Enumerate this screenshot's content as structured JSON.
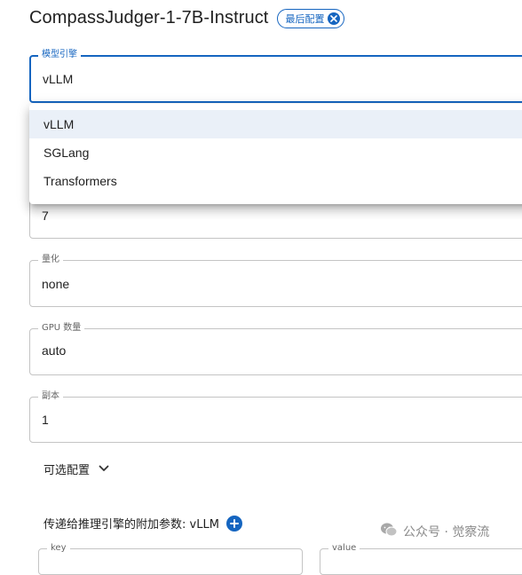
{
  "header": {
    "title": "CompassJudger-1-7B-Instruct",
    "chip_label": "最后配置"
  },
  "engine": {
    "label": "模型引擎",
    "value": "vLLM",
    "options": [
      "vLLM",
      "SGLang",
      "Transformers"
    ],
    "selected_index": 0
  },
  "hidden_field": {
    "value": "7"
  },
  "quantization": {
    "label": "量化",
    "value": "none"
  },
  "gpu_count": {
    "label": "GPU 数量",
    "value": "auto"
  },
  "replicas": {
    "label": "副本",
    "value": "1"
  },
  "optional": {
    "label": "可选配置"
  },
  "extra_params": {
    "label": "传递给推理引擎的附加参数: vLLM",
    "key_label": "key",
    "value_label": "value"
  },
  "watermark": {
    "text": "公众号 · 觉察流"
  },
  "colors": {
    "accent": "#1565c0",
    "border": "#c4c4c4",
    "selected_bg": "#eaf0f8"
  }
}
